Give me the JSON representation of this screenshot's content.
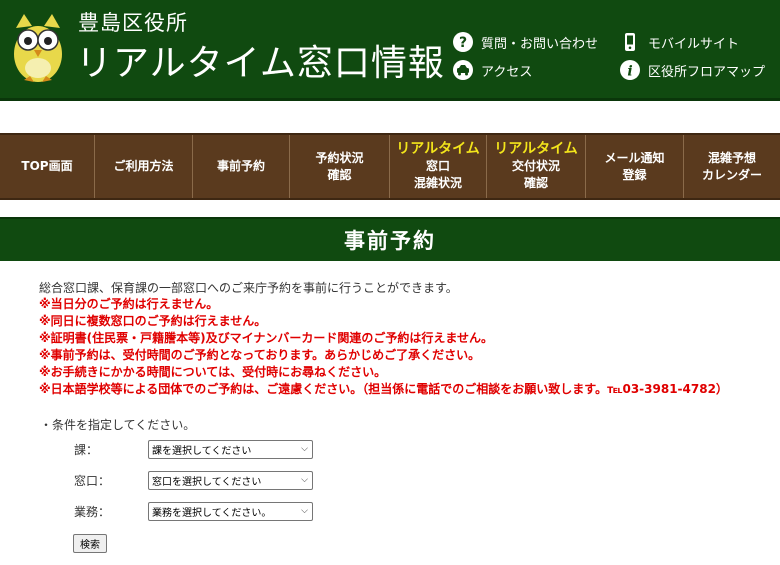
{
  "header": {
    "office_name": "豊島区役所",
    "site_title": "リアルタイム窓口情報",
    "links": [
      {
        "label": "質問・お問い合わせ",
        "icon": "question-icon"
      },
      {
        "label": "アクセス",
        "icon": "car-icon"
      },
      {
        "label": "モバイルサイト",
        "icon": "mobile-phone-icon"
      },
      {
        "label": "区役所フロアマップ",
        "icon": "info-icon"
      }
    ]
  },
  "nav": {
    "items": [
      {
        "l1": "TOP画面",
        "l2": "",
        "l3": ""
      },
      {
        "l1": "ご利用方法",
        "l2": "",
        "l3": ""
      },
      {
        "l1": "事前予約",
        "l2": "",
        "l3": ""
      },
      {
        "l1": "予約状況",
        "l2": "確認",
        "l3": ""
      },
      {
        "hl": "リアルタイム",
        "l1": "窓口",
        "l2": "混雑状況"
      },
      {
        "hl": "リアルタイム",
        "l1": "交付状況",
        "l2": "確認"
      },
      {
        "l1": "メール通知",
        "l2": "登録",
        "l3": ""
      },
      {
        "l1": "混雑予想",
        "l2": "カレンダー",
        "l3": ""
      }
    ]
  },
  "page": {
    "title": "事前予約",
    "intro": "総合窓口課、保育課の一部窓口へのご来庁予約を事前に行うことができます。",
    "notices": [
      "※当日分のご予約は行えません。",
      "※同日に複数窓口のご予約は行えません。",
      "※証明書(住民票・戸籍謄本等)及びマイナンバーカード関連のご予約は行えません。",
      "※事前予約は、受付時間のご予約となっております。あらかじめご了承ください。",
      "※お手続きにかかる時間については、受付時にお尋ねください。",
      "※日本語学校等による団体でのご予約は、ご遠慮ください。（担当係に電話でのご相談をお願い致します。℡03-3981-4782）"
    ]
  },
  "form": {
    "condition_label": "・条件を指定してください。",
    "rows": [
      {
        "label": "課：",
        "value": "課を選択してください"
      },
      {
        "label": "窓口：",
        "value": "窓口を選択してください"
      },
      {
        "label": "業務：",
        "value": "業務を選択してください。"
      }
    ],
    "search_label": "検索"
  },
  "colors": {
    "header_green": "#104a10",
    "nav_brown": "#5a3a1e",
    "highlight_yellow": "#f3e51b",
    "notice_red": "#e00000"
  }
}
